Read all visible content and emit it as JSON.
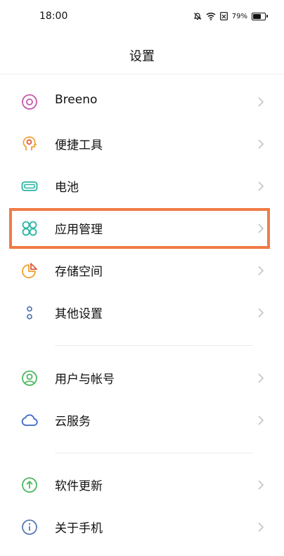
{
  "status_bar": {
    "time": "18:00",
    "battery": "79%",
    "icons": [
      "mute-bell-icon",
      "wifi-icon",
      "no-sim-icon",
      "battery-icon"
    ]
  },
  "page": {
    "title": "设置"
  },
  "settings": [
    {
      "label": "Breeno",
      "icon": "breeno-icon",
      "color": "#c65aa8"
    },
    {
      "label": "便捷工具",
      "icon": "head-gear-icon",
      "color": "#f0a030"
    },
    {
      "label": "电池",
      "icon": "battery-icon",
      "color": "#2ab5a3"
    },
    {
      "label": "应用管理",
      "icon": "apps-grid-icon",
      "color": "#2ab5a3"
    },
    {
      "label": "存储空间",
      "icon": "pie-chart-icon",
      "color": "#f0a030"
    },
    {
      "label": "其他设置",
      "icon": "dots-icon",
      "color": "#5a7ab8"
    },
    {
      "label": "用户与帐号",
      "icon": "user-icon",
      "color": "#4cb860"
    },
    {
      "label": "云服务",
      "icon": "cloud-icon",
      "color": "#3a66c4"
    },
    {
      "label": "软件更新",
      "icon": "update-arrow-icon",
      "color": "#4cb860"
    },
    {
      "label": "关于手机",
      "icon": "info-icon",
      "color": "#5a7ab8"
    }
  ],
  "highlight_color": "#f07b45"
}
